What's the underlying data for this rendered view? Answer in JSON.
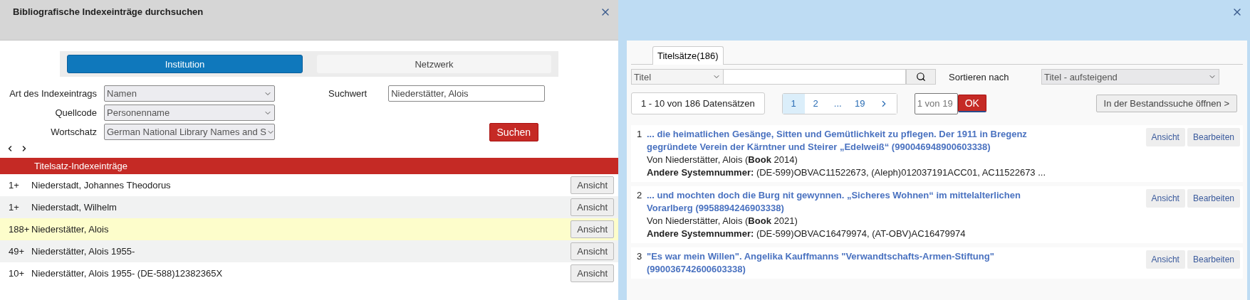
{
  "left_panel": {
    "title": "Bibliografische Indexeinträge durchsuchen",
    "tabs": [
      {
        "label": "Institution",
        "selected": true
      },
      {
        "label": "Netzwerk",
        "selected": false
      }
    ],
    "form": {
      "index_type": {
        "label": "Art des Indexeintrags",
        "value": "Namen"
      },
      "source_code": {
        "label": "Quellcode",
        "value": "Personenname"
      },
      "vocabulary": {
        "label": "Wortschatz",
        "value": "German National Library Names and S"
      },
      "search_value": {
        "label": "Suchwert",
        "value": "Niederstätter, Alois"
      },
      "search_button": "Suchen"
    },
    "table": {
      "header": "Titelsatz-Indexeinträge",
      "rows": [
        {
          "count": "1+",
          "name": "Niederstadt, Johannes Theodorus",
          "button": "Ansicht",
          "selected": false
        },
        {
          "count": "1+",
          "name": "Niederstadt, Wilhelm",
          "button": "Ansicht",
          "selected": false
        },
        {
          "count": "188+",
          "name": "Niederstätter, Alois",
          "button": "Ansicht",
          "selected": true
        },
        {
          "count": "49+",
          "name": "Niederstätter, Alois 1955-",
          "button": "Ansicht",
          "selected": false
        },
        {
          "count": "10+",
          "name": "Niederstätter, Alois 1955- (DE-588)12382365X",
          "button": "Ansicht",
          "selected": false
        }
      ]
    }
  },
  "right_panel": {
    "tabs": [
      {
        "label": "Titelsätze(186)",
        "selected": true
      }
    ],
    "search": {
      "field": "Titel",
      "sort_label": "Sortieren nach",
      "sort_value": "Titel - aufsteigend"
    },
    "paging": {
      "range": "1 - 10 von 186 Datensätzen",
      "pages": [
        {
          "label": "1",
          "selected": true
        },
        {
          "label": "2",
          "selected": false
        },
        {
          "label": "...",
          "selected": false
        },
        {
          "label": "19",
          "selected": false
        }
      ],
      "page_input_placeholder": "1 von 19",
      "ok": "OK",
      "open_button": "In der Bestandssuche öffnen >"
    },
    "results": [
      {
        "number": "1",
        "title": "... die heimatlichen Gesänge, Sitten und Gemütlichkeit zu pflegen. Der 1911 in Bregenz gegründete Verein der Kärntner und Steirer „Edelweiß“ (990046948900603338)",
        "author": "Von Niederstätter, Alois (**Book** 2014)",
        "system_numbers": "**Andere Systemnummer:** (DE-599)OBVAC11522673, (Aleph)012037191ACC01, AC11522673 ...",
        "buttons": [
          "Ansicht",
          "Bearbeiten"
        ]
      },
      {
        "number": "2",
        "title": "... und mochten doch die Burg nit gewynnen. „Sicheres Wohnen“ im mittelalterlichen Vorarlberg (9958894246903338)",
        "author": "Von Niederstätter, Alois (**Book** 2021)",
        "system_numbers": "**Andere Systemnummer:** (DE-599)OBVAC16479974, (AT-OBV)AC16479974",
        "buttons": [
          "Ansicht",
          "Bearbeiten"
        ]
      },
      {
        "number": "3",
        "title": "\"Es war mein Willen\". Angelika Kauffmanns \"Verwandtschafts-Armen-Stiftung\" (990036742600603338)",
        "buttons": [
          "Ansicht",
          "Bearbeiten"
        ]
      }
    ]
  }
}
